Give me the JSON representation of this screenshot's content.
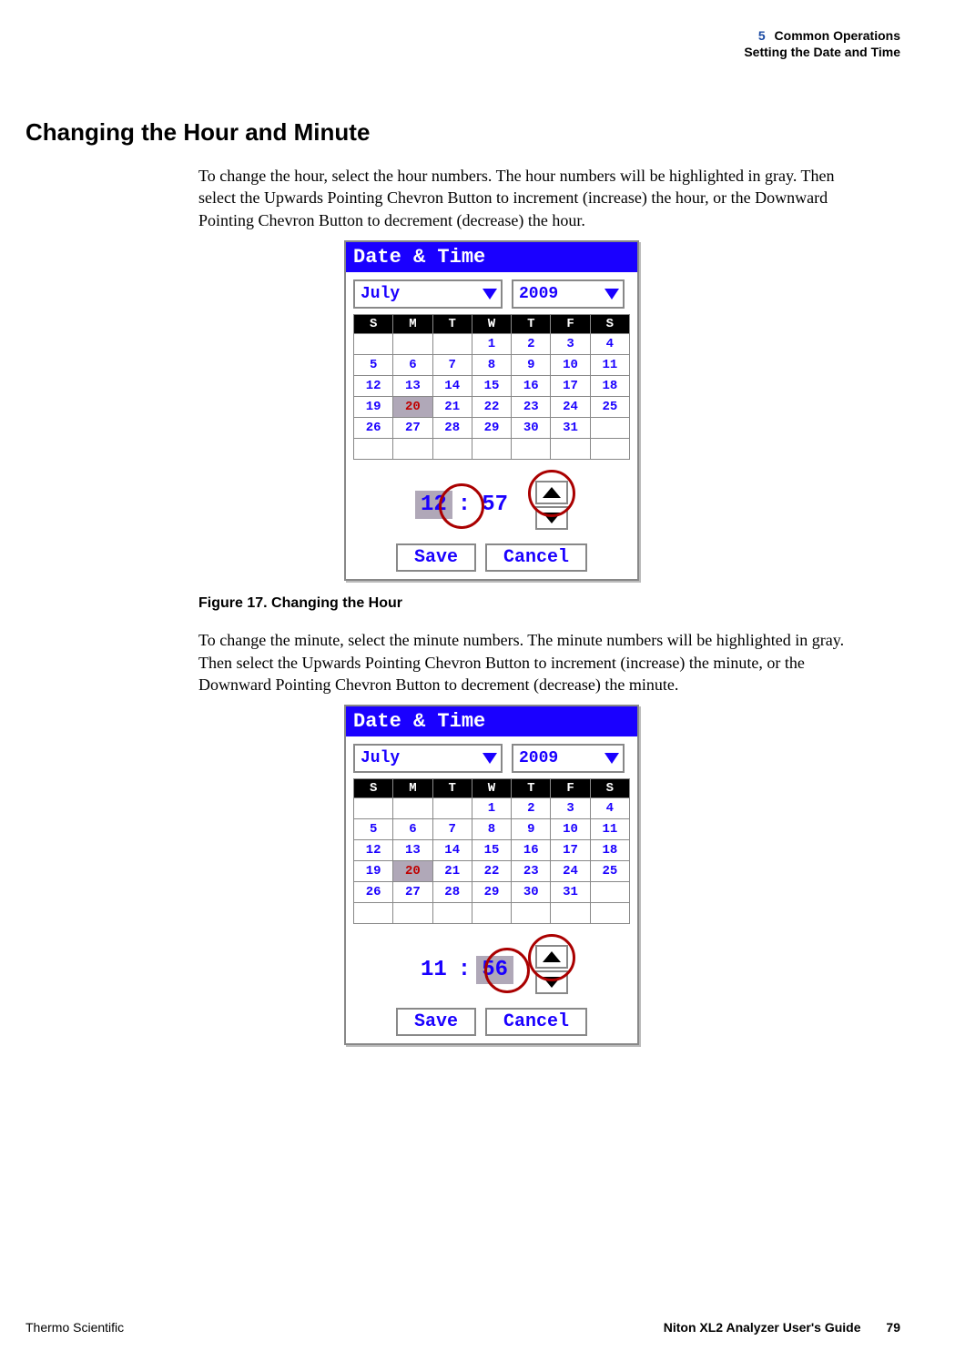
{
  "header": {
    "chapter_number": "5",
    "chapter_title": "Common Operations",
    "subtitle": "Setting the Date and Time"
  },
  "section_heading": "Changing the Hour and Minute",
  "para1": "To change the hour, select the hour numbers. The hour numbers will be highlighted in gray. Then select the Upwards Pointing Chevron Button to increment (increase) the hour, or the Downward Pointing Chevron Button to decrement (decrease) the hour.",
  "figure1": {
    "titlebar": "Date & Time",
    "month": "July",
    "year": "2009",
    "weekdays": [
      "S",
      "M",
      "T",
      "W",
      "T",
      "F",
      "S"
    ],
    "weeks": [
      [
        "",
        "",
        "",
        "1",
        "2",
        "3",
        "4"
      ],
      [
        "5",
        "6",
        "7",
        "8",
        "9",
        "10",
        "11"
      ],
      [
        "12",
        "13",
        "14",
        "15",
        "16",
        "17",
        "18"
      ],
      [
        "19",
        "20",
        "21",
        "22",
        "23",
        "24",
        "25"
      ],
      [
        "26",
        "27",
        "28",
        "29",
        "30",
        "31",
        ""
      ],
      [
        "",
        "",
        "",
        "",
        "",
        "",
        ""
      ]
    ],
    "selected_day": "20",
    "hour": "12",
    "minute": "57",
    "save": "Save",
    "cancel": "Cancel",
    "caption": "Figure 17.   Changing the Hour"
  },
  "para2": "To change the minute, select the minute numbers. The minute numbers will be highlighted in gray. Then select the Upwards Pointing Chevron Button to increment (increase) the minute, or the Downward Pointing Chevron Button to decrement (decrease) the minute.",
  "figure2": {
    "titlebar": "Date & Time",
    "month": "July",
    "year": "2009",
    "weekdays": [
      "S",
      "M",
      "T",
      "W",
      "T",
      "F",
      "S"
    ],
    "weeks": [
      [
        "",
        "",
        "",
        "1",
        "2",
        "3",
        "4"
      ],
      [
        "5",
        "6",
        "7",
        "8",
        "9",
        "10",
        "11"
      ],
      [
        "12",
        "13",
        "14",
        "15",
        "16",
        "17",
        "18"
      ],
      [
        "19",
        "20",
        "21",
        "22",
        "23",
        "24",
        "25"
      ],
      [
        "26",
        "27",
        "28",
        "29",
        "30",
        "31",
        ""
      ],
      [
        "",
        "",
        "",
        "",
        "",
        "",
        ""
      ]
    ],
    "selected_day": "20",
    "hour": "11",
    "minute": "56",
    "save": "Save",
    "cancel": "Cancel"
  },
  "footer": {
    "left": "Thermo Scientific",
    "right": "Niton XL2 Analyzer User's Guide",
    "page": "79"
  }
}
